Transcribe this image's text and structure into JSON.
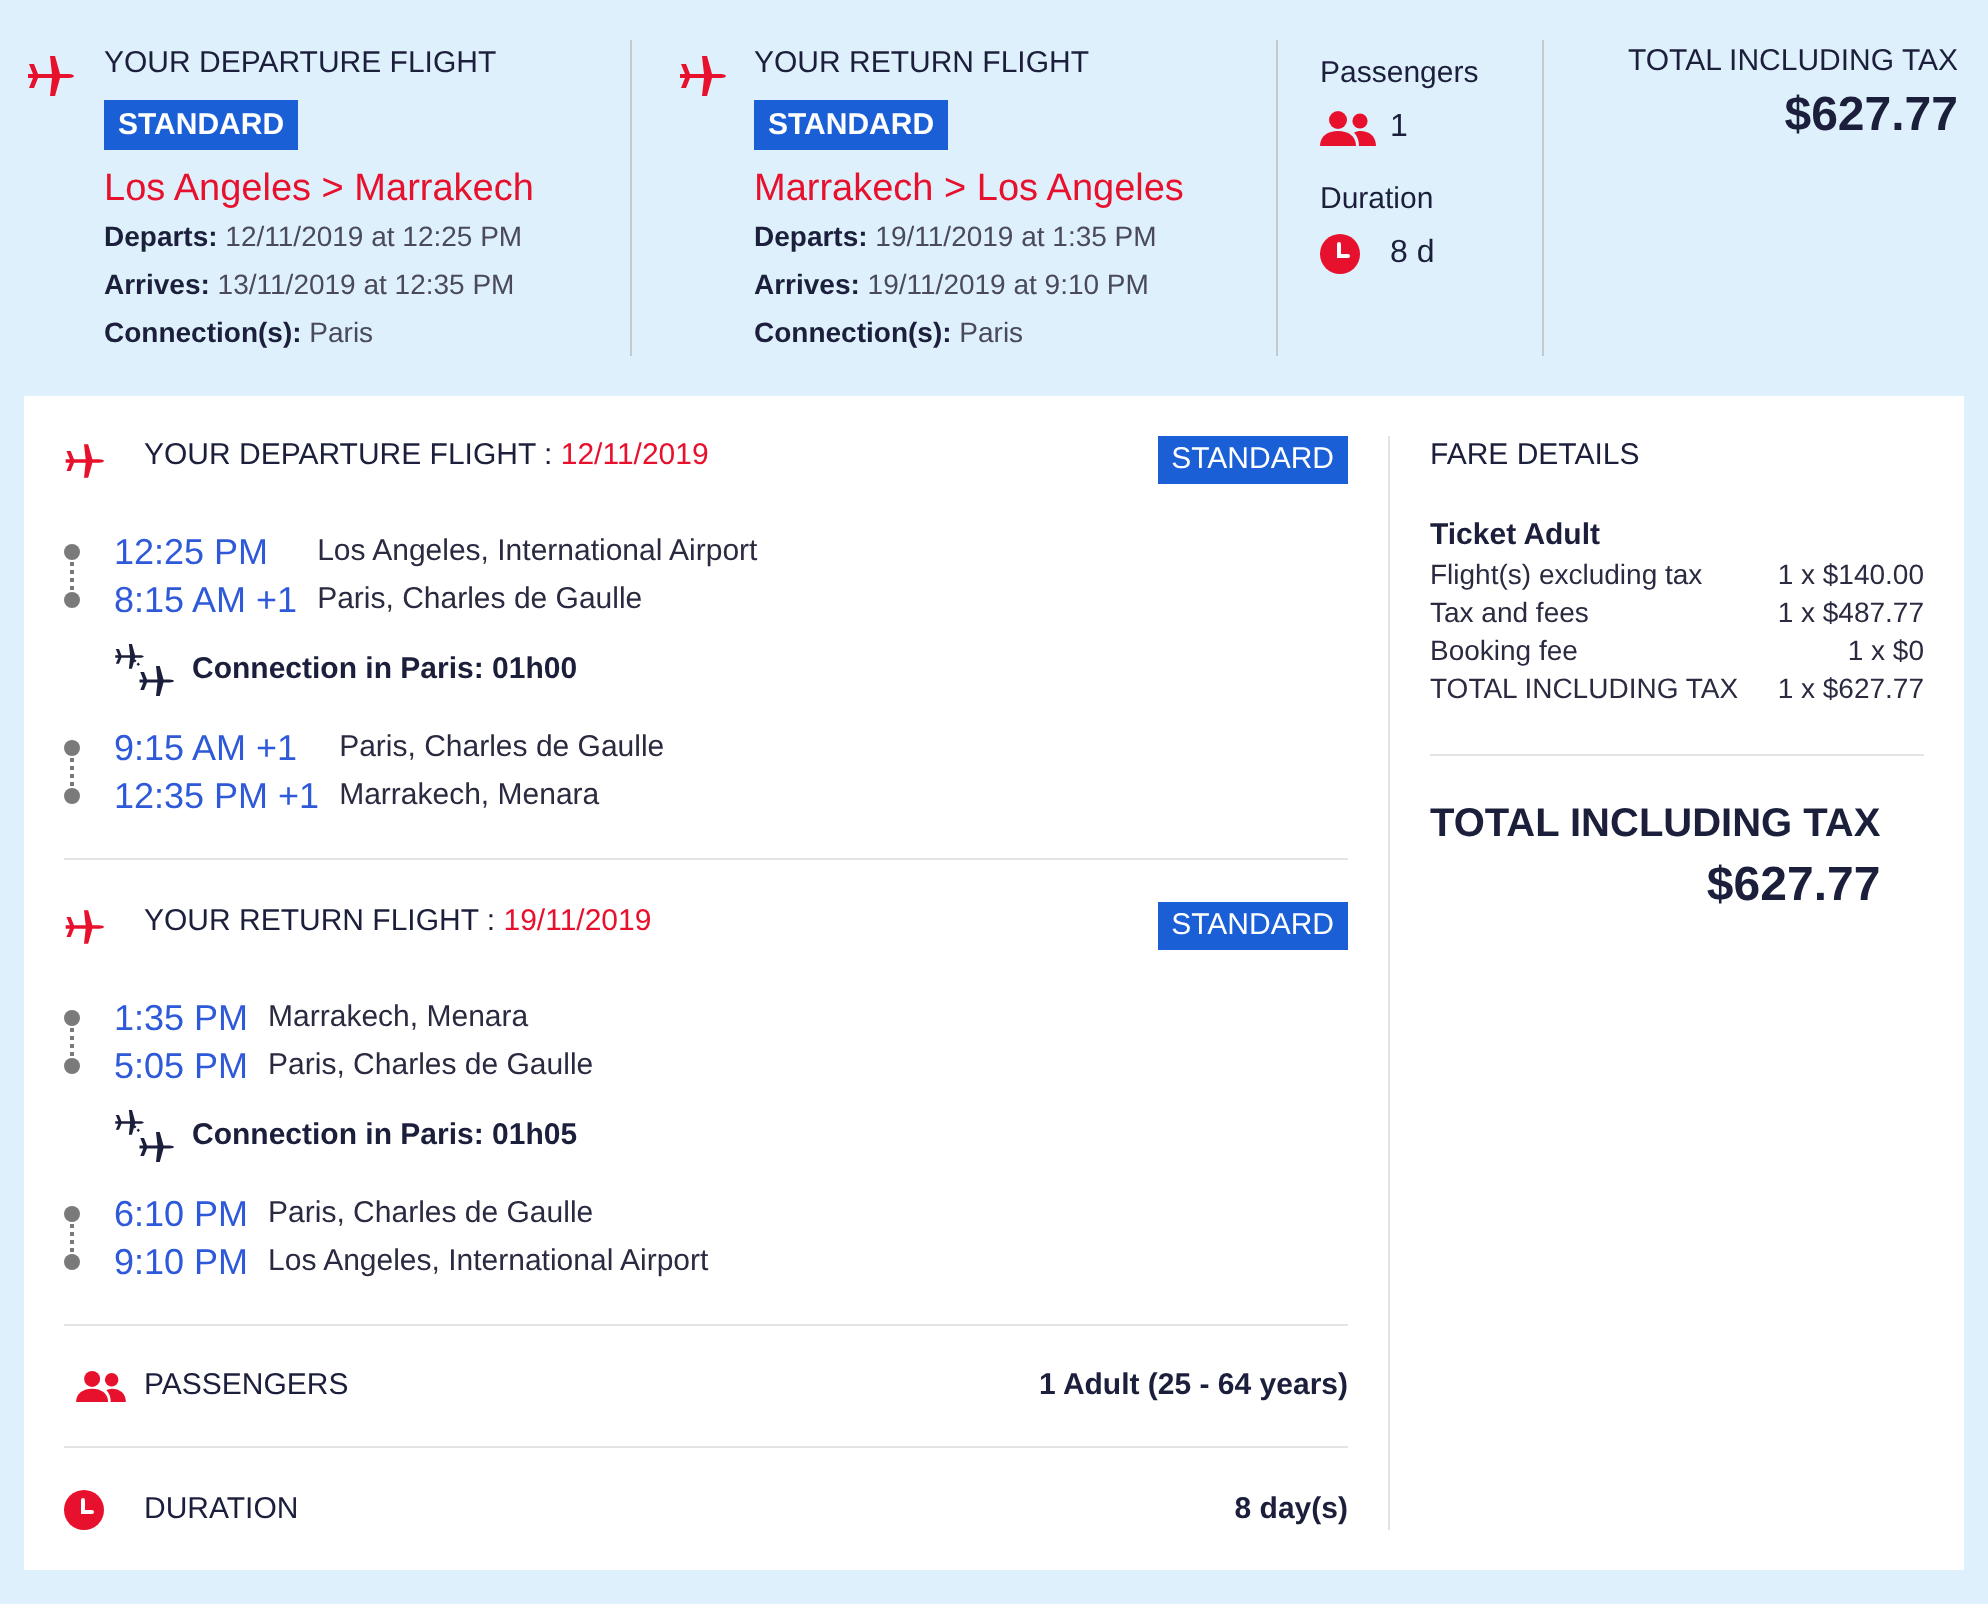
{
  "summary": {
    "flights": [
      {
        "title": "YOUR DEPARTURE FLIGHT",
        "fare_class": "STANDARD",
        "route": "Los Angeles > Marrakech",
        "details": [
          {
            "label": "Departs:",
            "value": "12/11/2019 at 12:25 PM"
          },
          {
            "label": "Arrives:",
            "value": "13/11/2019 at 12:35 PM"
          },
          {
            "label": "Connection(s):",
            "value": "Paris"
          }
        ]
      },
      {
        "title": "YOUR RETURN FLIGHT",
        "fare_class": "STANDARD",
        "route": "Marrakech > Los Angeles",
        "details": [
          {
            "label": "Departs:",
            "value": "19/11/2019 at 1:35 PM"
          },
          {
            "label": "Arrives:",
            "value": "19/11/2019 at 9:10 PM"
          },
          {
            "label": "Connection(s):",
            "value": "Paris"
          }
        ]
      }
    ],
    "passengers": {
      "label": "Passengers",
      "count": "1"
    },
    "duration": {
      "label": "Duration",
      "value": "8 d"
    },
    "total": {
      "label": "TOTAL INCLUDING TAX",
      "amount": "$627.77"
    }
  },
  "itinerary": {
    "flights": [
      {
        "title": "YOUR DEPARTURE FLIGHT :",
        "date": "12/11/2019",
        "fare_class": "STANDARD",
        "items": [
          {
            "kind": "segment",
            "stops": [
              {
                "time": "12:25 PM",
                "place": "Los Angeles, International Airport"
              },
              {
                "time": "8:15 AM +1",
                "place": "Paris, Charles de Gaulle"
              }
            ]
          },
          {
            "kind": "connection",
            "text": "Connection in Paris: 01h00"
          },
          {
            "kind": "segment",
            "stops": [
              {
                "time": "9:15 AM +1",
                "place": "Paris, Charles de Gaulle"
              },
              {
                "time": "12:35 PM +1",
                "place": "Marrakech, Menara"
              }
            ]
          }
        ]
      },
      {
        "title": "YOUR RETURN FLIGHT :",
        "date": "19/11/2019",
        "fare_class": "STANDARD",
        "items": [
          {
            "kind": "segment",
            "stops": [
              {
                "time": "1:35 PM",
                "place": "Marrakech, Menara"
              },
              {
                "time": "5:05 PM",
                "place": "Paris, Charles de Gaulle"
              }
            ]
          },
          {
            "kind": "connection",
            "text": "Connection in Paris: 01h05"
          },
          {
            "kind": "segment",
            "stops": [
              {
                "time": "6:10 PM",
                "place": "Paris, Charles de Gaulle"
              },
              {
                "time": "9:10 PM",
                "place": "Los Angeles, International Airport"
              }
            ]
          }
        ]
      }
    ],
    "info_rows": [
      {
        "kind": "passengers",
        "label": "PASSENGERS",
        "value": "1 Adult (25 - 64 years)"
      },
      {
        "kind": "duration",
        "label": "DURATION",
        "value": "8 day(s)"
      }
    ]
  },
  "fare_details": {
    "title": "FARE DETAILS",
    "ticket": "Ticket Adult",
    "lines": [
      {
        "label": "Flight(s) excluding tax",
        "value": "1 x $140.00"
      },
      {
        "label": "Tax and fees",
        "value": "1 x $487.77"
      },
      {
        "label": "Booking fee",
        "value": "1 x $0"
      },
      {
        "label": "TOTAL INCLUDING TAX",
        "value": "1 x $627.77"
      }
    ],
    "total_label": "TOTAL INCLUDING TAX",
    "total_amount": "$627.77"
  }
}
